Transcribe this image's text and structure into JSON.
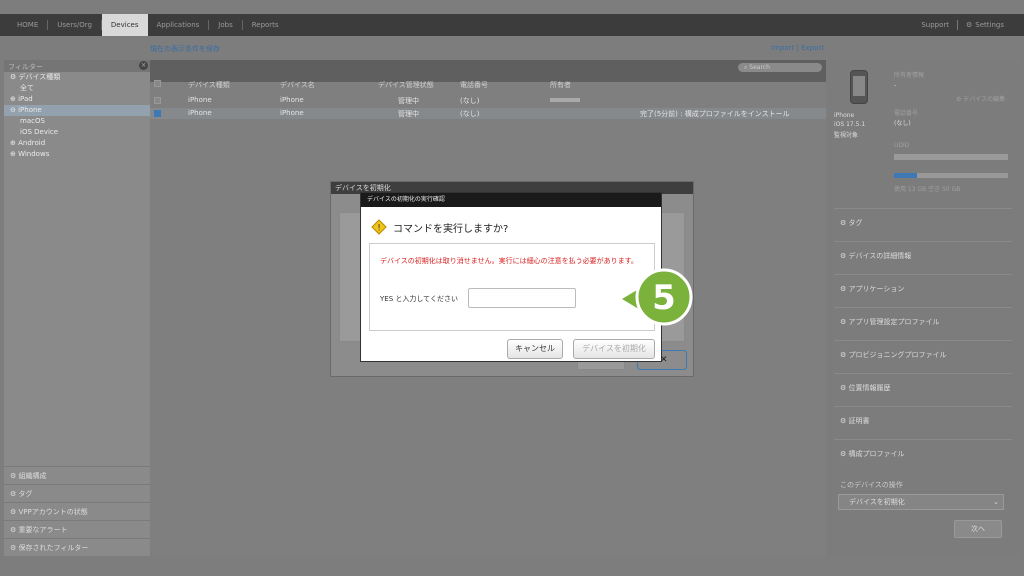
{
  "nav": {
    "items": [
      "HOME",
      "Users/Org",
      "Devices",
      "Applications",
      "Jobs",
      "Reports"
    ],
    "active": "Devices",
    "support": "Support",
    "settings": "Settings"
  },
  "toolbar": {
    "save_filter": "現在の表示条件を保存",
    "import_export": "Import | Export"
  },
  "sidebar": {
    "filter_label": "フィルター",
    "close": "×",
    "device_type": "デバイス種類",
    "items": [
      "全て",
      "iPad",
      "iPhone",
      "macOS",
      "iOS Device",
      "Android",
      "Windows"
    ],
    "selected": "iPhone",
    "bottom": [
      "組織構成",
      "タグ",
      "VPPアカウントの状態",
      "重要なアラート",
      "保存されたフィルター"
    ]
  },
  "table": {
    "search_placeholder": "Search",
    "columns": [
      "デバイス種類",
      "デバイス名",
      "デバイス管理状態",
      "電話番号",
      "所有者"
    ],
    "rows": [
      {
        "type": "iPhone",
        "name": "iPhone",
        "status": "管理中",
        "phone": "(なし)",
        "owner": "",
        "note": ""
      },
      {
        "type": "iPhone",
        "name": "iPhone",
        "status": "管理中",
        "phone": "(なし)",
        "owner": "",
        "note": "完了(5分前) : 構成プロファイルをインストール"
      }
    ]
  },
  "right_panel": {
    "owner_info": "所有者情報",
    "owner_value": "-",
    "edit_device": "デバイスの編集",
    "device_name": "iPhone",
    "os": "iOS 17.5.1",
    "supervised": "監視対象",
    "phone_label": "電話番号",
    "phone_value": "(なし)",
    "udid_label": "UDID",
    "storage": "使用 13 GB  空き 50 GB",
    "storage_used_fraction": 0.2,
    "sections": [
      "タグ",
      "デバイスの詳細情報",
      "アプリケーション",
      "アプリ管理設定プロファイル",
      "プロビジョニングプロファイル",
      "位置情報履歴",
      "証明書",
      "構成プロファイル"
    ],
    "device_actions": "このデバイスの操作",
    "action_select": "デバイスを初期化",
    "next_button": "次へ"
  },
  "background_modal": {
    "title": "デバイスを初期化"
  },
  "dialog": {
    "title": "デバイスの初期化の実行確認",
    "question": "コマンドを実行しますか?",
    "warning": "デバイスの初期化は取り消せません。実行には細心の注意を払う必要があります。",
    "input_label": "YES と入力してください",
    "input_value": "",
    "cancel": "キャンセル",
    "confirm": "デバイスを初期化"
  },
  "step_badge": "5",
  "colors": {
    "step_green": "#7ab23c",
    "warning_red": "#d92020",
    "accent_blue": "#3f79b5"
  }
}
